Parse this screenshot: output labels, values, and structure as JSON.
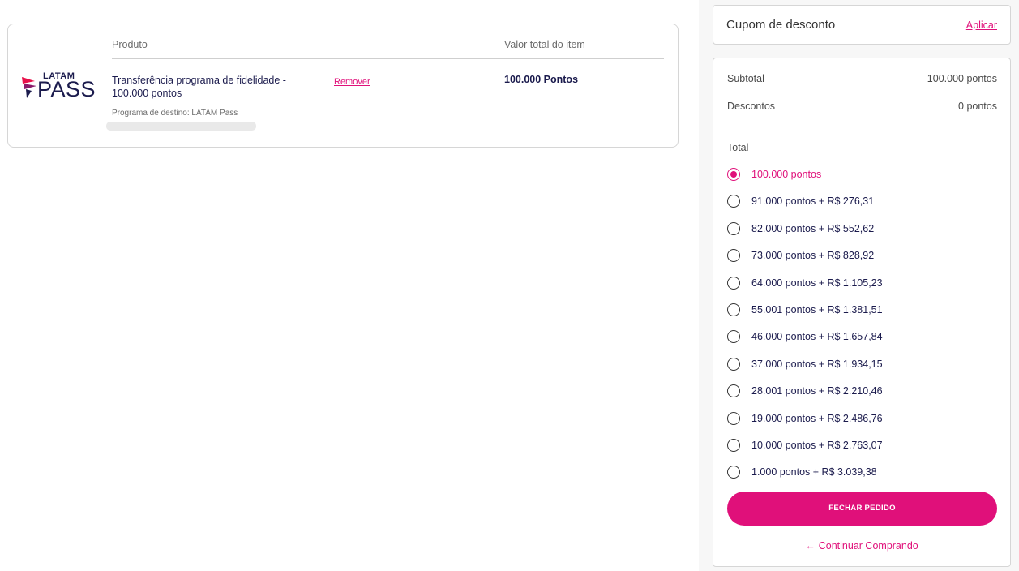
{
  "cart": {
    "col_product": "Produto",
    "col_total": "Valor total do item",
    "brand": {
      "top": "LATAM",
      "bottom": "PASS"
    },
    "product_name": "Transferência programa de fidelidade - 100.000 pontos",
    "remove_label": "Remover",
    "item_value": "100.000 Pontos",
    "destination": "Programa de destino: LATAM Pass"
  },
  "coupon": {
    "label": "Cupom de desconto",
    "apply_label": "Aplicar"
  },
  "summary": {
    "subtotal_label": "Subtotal",
    "subtotal_value": "100.000 pontos",
    "discount_label": "Descontos",
    "discount_value": "0 pontos",
    "total_label": "Total",
    "options": [
      "100.000 pontos",
      "91.000 pontos + R$ 276,31",
      "82.000 pontos + R$ 552,62",
      "73.000 pontos + R$ 828,92",
      "64.000 pontos + R$ 1.105,23",
      "55.001 pontos + R$ 1.381,51",
      "46.000 pontos + R$ 1.657,84",
      "37.000 pontos + R$ 1.934,15",
      "28.001 pontos + R$ 2.210,46",
      "19.000 pontos + R$ 2.486,76",
      "10.000 pontos + R$ 2.763,07",
      "1.000 pontos + R$ 3.039,38"
    ],
    "selected_index": 0,
    "checkout_label": "FECHAR PEDIDO",
    "continue_label": "Continuar Comprando"
  },
  "colors": {
    "accent": "#e0107a",
    "text_dark": "#1b1b4d",
    "brand_red": "#e8114b",
    "brand_purple": "#5c1a6e"
  }
}
